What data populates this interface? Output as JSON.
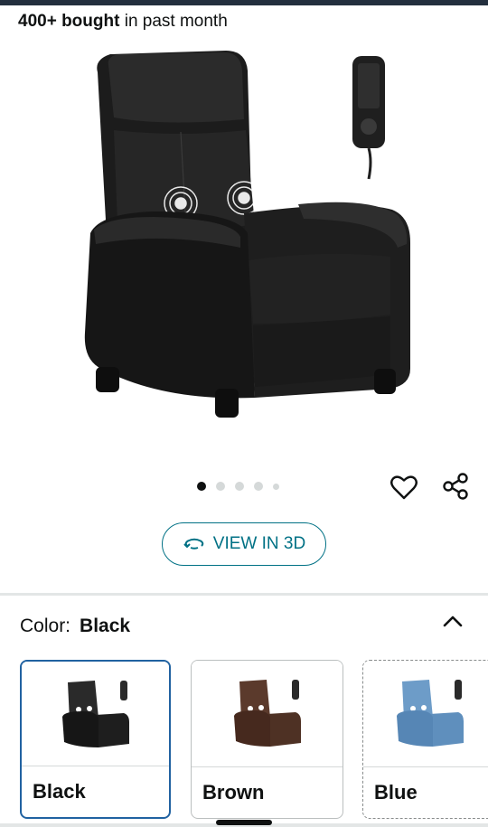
{
  "social_proof": {
    "count": "400+ bought",
    "suffix": " in past month"
  },
  "gallery": {
    "image_count": 5,
    "active_index": 0
  },
  "view3d": {
    "label": "VIEW IN 3D"
  },
  "color": {
    "label": "Color:",
    "selected": "Black",
    "options": [
      {
        "name": "Black",
        "seat_color": "#2a2a2a"
      },
      {
        "name": "Brown",
        "seat_color": "#5b3a2c"
      },
      {
        "name": "Blue",
        "seat_color": "#6d9cc8"
      }
    ]
  },
  "colors": {
    "link": "#007185",
    "selected_border": "#2162a1",
    "text": "#0f1111"
  },
  "icons": {
    "wishlist": "heart-icon",
    "share": "share-icon",
    "collapse": "chevron-up-icon",
    "rotate": "rotate-3d-icon"
  }
}
